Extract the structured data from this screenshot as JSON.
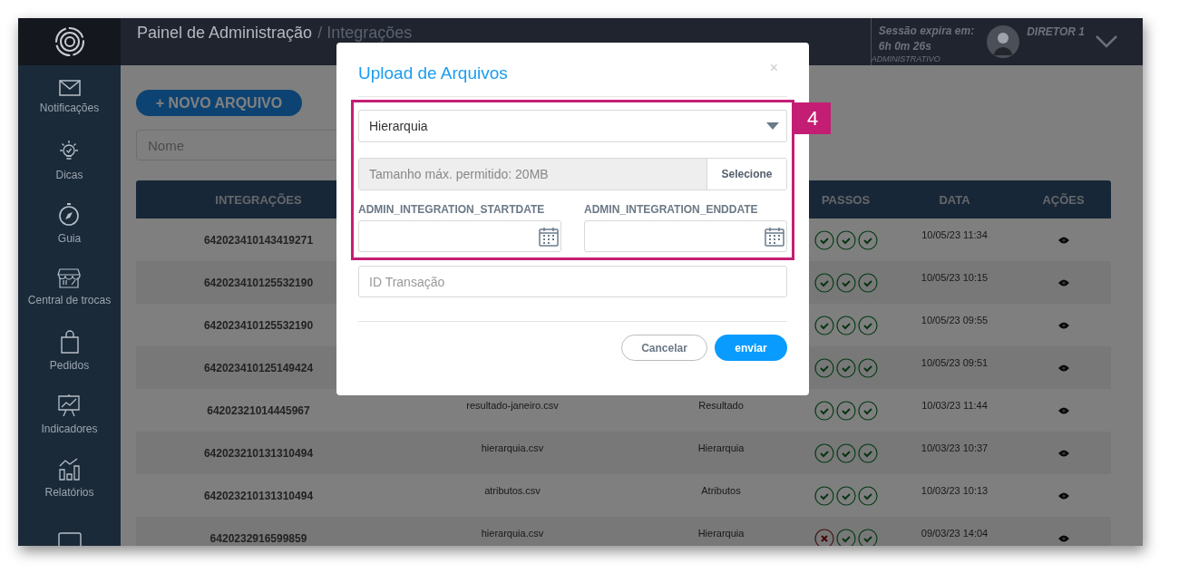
{
  "header": {
    "title": "Painel de Administração",
    "breadcrumb": "/ Integrações",
    "session_label": "Sessão expira em:",
    "session_time": "6h 0m 26s",
    "role": "ADMINISTRATIVO",
    "user": "DIRETOR 1"
  },
  "sidebar": {
    "items": [
      {
        "kind": "mail",
        "label": "Notificações"
      },
      {
        "kind": "bulb",
        "label": "Dicas"
      },
      {
        "kind": "compass",
        "label": "Guia"
      },
      {
        "kind": "store",
        "label": "Central de trocas"
      },
      {
        "kind": "bag",
        "label": "Pedidos"
      },
      {
        "kind": "board",
        "label": "Indicadores"
      },
      {
        "kind": "bars",
        "label": "Relatórios"
      },
      {
        "kind": "screen"
      }
    ]
  },
  "new_button": "+ NOVO ARQUIVO",
  "search": {
    "placeholder": "Nome"
  },
  "table": {
    "columns": [
      "INTEGRAÇÕES",
      "PASSOS",
      "DATA",
      "AÇÕES"
    ],
    "rows": [
      {
        "id": "642023410143419271",
        "steps": [
          {
            "ok": true
          },
          {
            "ok": true
          },
          {
            "ok": true
          }
        ],
        "date": "10/05/23 11:34"
      },
      {
        "id": "642023410125532190",
        "steps": [
          {
            "ok": true
          },
          {
            "ok": true
          },
          {
            "ok": true
          }
        ],
        "date": "10/05/23 10:15"
      },
      {
        "id": "642023410125532190",
        "steps": [
          {
            "ok": true
          },
          {
            "ok": true
          },
          {
            "ok": true
          }
        ],
        "date": "10/05/23 09:55"
      },
      {
        "id": "642023410125149424",
        "steps": [
          {
            "ok": true
          },
          {
            "ok": true
          },
          {
            "ok": true
          }
        ],
        "date": "10/05/23 09:51"
      },
      {
        "id": "64202321014445967",
        "file": "resultado-janeiro.csv",
        "type": "Resultado",
        "steps": [
          {
            "ok": true
          },
          {
            "ok": true
          },
          {
            "ok": true
          }
        ],
        "date": "10/03/23 11:44"
      },
      {
        "id": "642023210131310494",
        "file": "hierarquia.csv",
        "type": "Hierarquia",
        "steps": [
          {
            "ok": true
          },
          {
            "ok": true
          },
          {
            "ok": true
          }
        ],
        "date": "10/03/23 10:37"
      },
      {
        "id": "642023210131310494",
        "file": "atributos.csv",
        "type": "Atributos",
        "steps": [
          {
            "ok": true
          },
          {
            "ok": true
          },
          {
            "ok": true
          }
        ],
        "date": "10/03/23 10:13"
      },
      {
        "id": "6420232916599859",
        "file": "hierarquia.csv",
        "type": "Hierarquia",
        "steps": [
          {
            "ok": false
          },
          {
            "ok": true
          },
          {
            "ok": true
          }
        ],
        "date": "09/03/23 14:04"
      }
    ]
  },
  "modal": {
    "title": "Upload de Arquivos",
    "close": "×",
    "select": {
      "value": "Hierarquia"
    },
    "file": {
      "placeholder": "Tamanho máx. permitido: 20MB",
      "button": "Selecione"
    },
    "start_label": "ADMIN_INTEGRATION_STARTDATE",
    "end_label": "ADMIN_INTEGRATION_ENDDATE",
    "transaction": {
      "placeholder": "ID Transação"
    },
    "cancel": "Cancelar",
    "submit": "enviar"
  },
  "annotation": {
    "number": "4"
  }
}
